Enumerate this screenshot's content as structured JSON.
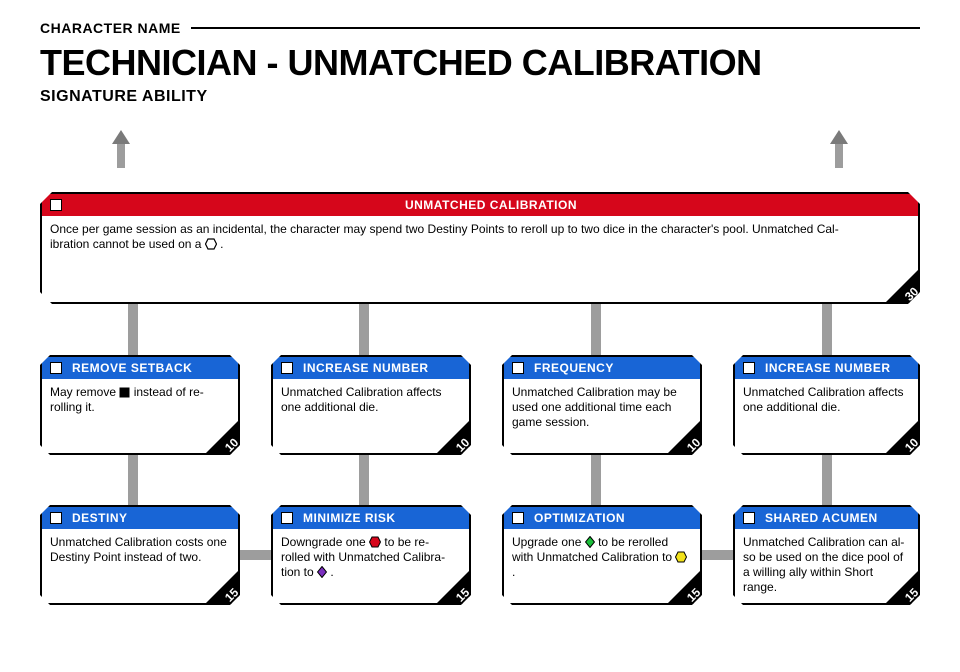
{
  "header": {
    "char_label": "CHARACTER NAME",
    "title": "TECHNICIAN - UNMATCHED CALIBRATION",
    "subtitle": "SIGNATURE ABILITY"
  },
  "root": {
    "title": "UNMATCHED CALIBRATION",
    "body_a": "Once per game session as an incidental, the character may spend two Destiny Points to reroll up to two dice in the character's pool. Unmatched Cal-",
    "body_b": "ibration cannot be used on a ",
    "body_c": ".",
    "cost": "30"
  },
  "row1": [
    {
      "title": "REMOVE SETBACK",
      "body_a": "May remove ",
      "body_b": " instead of re-",
      "body_c": "rolling it.",
      "cost": "10"
    },
    {
      "title": "INCREASE NUMBER",
      "body": "Unmatched Calibration affects one additional die.",
      "cost": "10"
    },
    {
      "title": "FREQUENCY",
      "body": "Unmatched Calibration may be used one additional time each game session.",
      "cost": "10"
    },
    {
      "title": "INCREASE NUMBER",
      "body": "Unmatched Calibration affects one additional die.",
      "cost": "10"
    }
  ],
  "row2": [
    {
      "title": "DESTINY",
      "body": "Unmatched Calibration costs one Destiny Point instead of two.",
      "cost": "15"
    },
    {
      "title": "MINIMIZE RISK",
      "body_a": "Downgrade one ",
      "body_b": " to be re-",
      "body_c": "rolled with Unmatched Calibra-",
      "body_d": "tion to ",
      "body_e": ".",
      "cost": "15"
    },
    {
      "title": "OPTIMIZATION",
      "body_a": "Upgrade one ",
      "body_b": " to be rerolled with Unmatched Calibration to ",
      "body_c": ".",
      "cost": "15"
    },
    {
      "title": "SHARED ACUMEN",
      "body": "Unmatched Calibration can al-\nso be used on the dice pool of a willing ally within Short range.",
      "cost": "15"
    }
  ]
}
